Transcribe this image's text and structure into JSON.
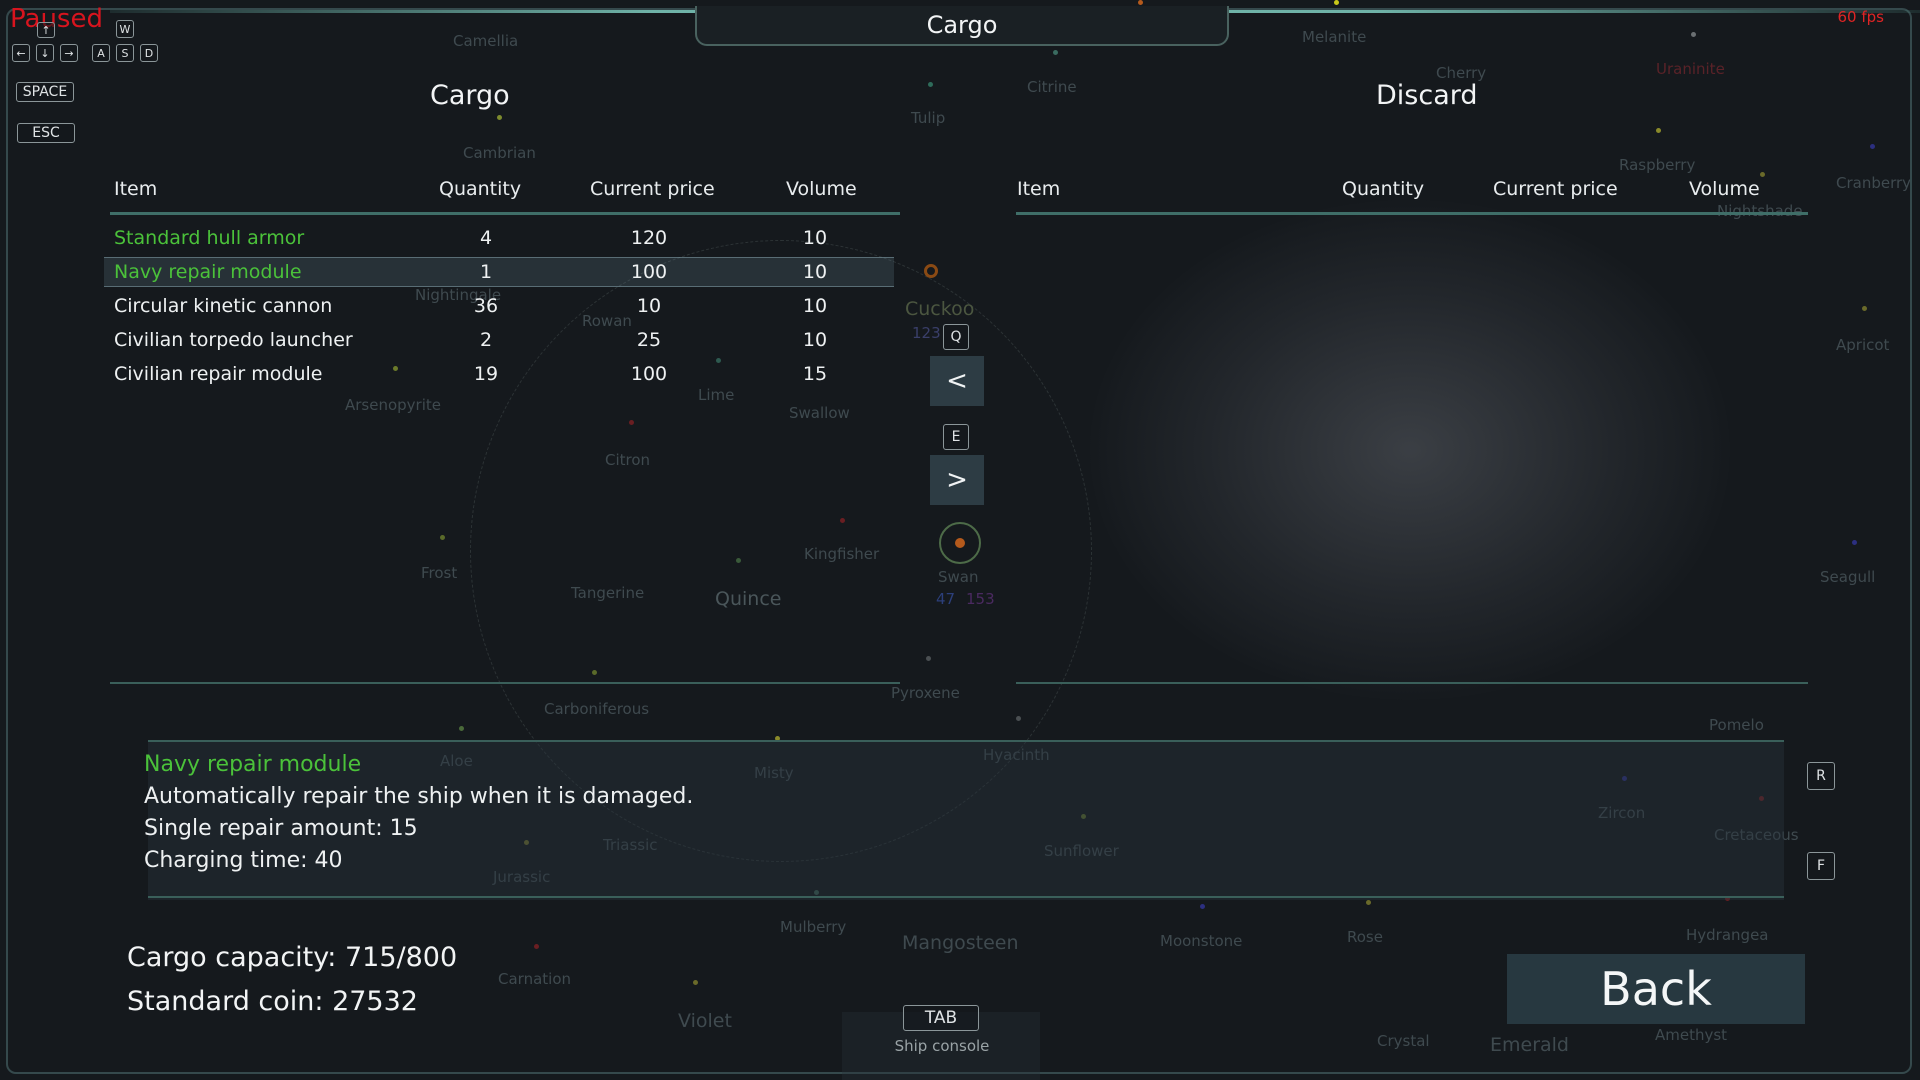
{
  "hud": {
    "paused_label": "Paused",
    "fps_label": "60 fps",
    "keys": {
      "up": "↑",
      "left": "←",
      "down": "↓",
      "right": "→",
      "w": "W",
      "a": "A",
      "s": "S",
      "d": "D",
      "space": "SPACE",
      "esc": "ESC"
    }
  },
  "window": {
    "title": "Cargo"
  },
  "cargo_panel": {
    "title": "Cargo",
    "columns": [
      "Item",
      "Quantity",
      "Current price",
      "Volume"
    ],
    "rows": [
      {
        "item": "Standard hull armor",
        "quantity": "4",
        "price": "120",
        "volume": "10"
      },
      {
        "item": "Navy repair module",
        "quantity": "1",
        "price": "100",
        "volume": "10"
      },
      {
        "item": "Circular kinetic cannon",
        "quantity": "36",
        "price": "10",
        "volume": "10"
      },
      {
        "item": "Civilian torpedo launcher",
        "quantity": "2",
        "price": "25",
        "volume": "10"
      },
      {
        "item": "Civilian repair module",
        "quantity": "19",
        "price": "100",
        "volume": "15"
      }
    ]
  },
  "discard_panel": {
    "title": "Discard",
    "columns": [
      "Item",
      "Quantity",
      "Current price",
      "Volume"
    ]
  },
  "transfer": {
    "q_key": "Q",
    "left_arrow": "<",
    "e_key": "E",
    "right_arrow": ">"
  },
  "detail": {
    "name": "Navy repair module",
    "description": "Automatically repair the ship when it is damaged.",
    "stat1": "Single repair amount: 15",
    "stat2": "Charging time: 40",
    "r_key": "R",
    "f_key": "F"
  },
  "footer": {
    "capacity": "Cargo capacity: 715/800",
    "coin": "Standard coin: 27532",
    "back_label": "Back",
    "tab_key": "TAB",
    "tab_label": "Ship console"
  },
  "map": {
    "systems": [
      "Camellia",
      "Cambrian",
      "Citrine",
      "Tulip",
      "Melanite",
      "Cherry",
      "Uraninite",
      "Raspberry",
      "Cranberry",
      "Nightshade",
      "Apricot",
      "Nightingale",
      "Rowan",
      "Cuckoo",
      "Arsenopyrite",
      "Lime",
      "Swallow",
      "Citron",
      "Frost",
      "Kingfisher",
      "Tangerine",
      "Quince",
      "Swan",
      "Seagull",
      "Carboniferous",
      "Pyroxene",
      "Aloe",
      "Misty",
      "Hyacinth",
      "Pomelo",
      "Zircon",
      "Cretaceous",
      "Triassic",
      "Sunflower",
      "Jurassic",
      "Mulberry",
      "Mangosteen",
      "Moonstone",
      "Rose",
      "Hydrangea",
      "Carnation",
      "Violet",
      "Crystal",
      "Emerald",
      "Amethyst"
    ],
    "swan_values": [
      "47",
      "153"
    ],
    "cuckoo_value": "123",
    "colors": {
      "accent": "#6fb3a8",
      "selected_text": "#4bc23a",
      "paused": "#d8141e"
    }
  }
}
